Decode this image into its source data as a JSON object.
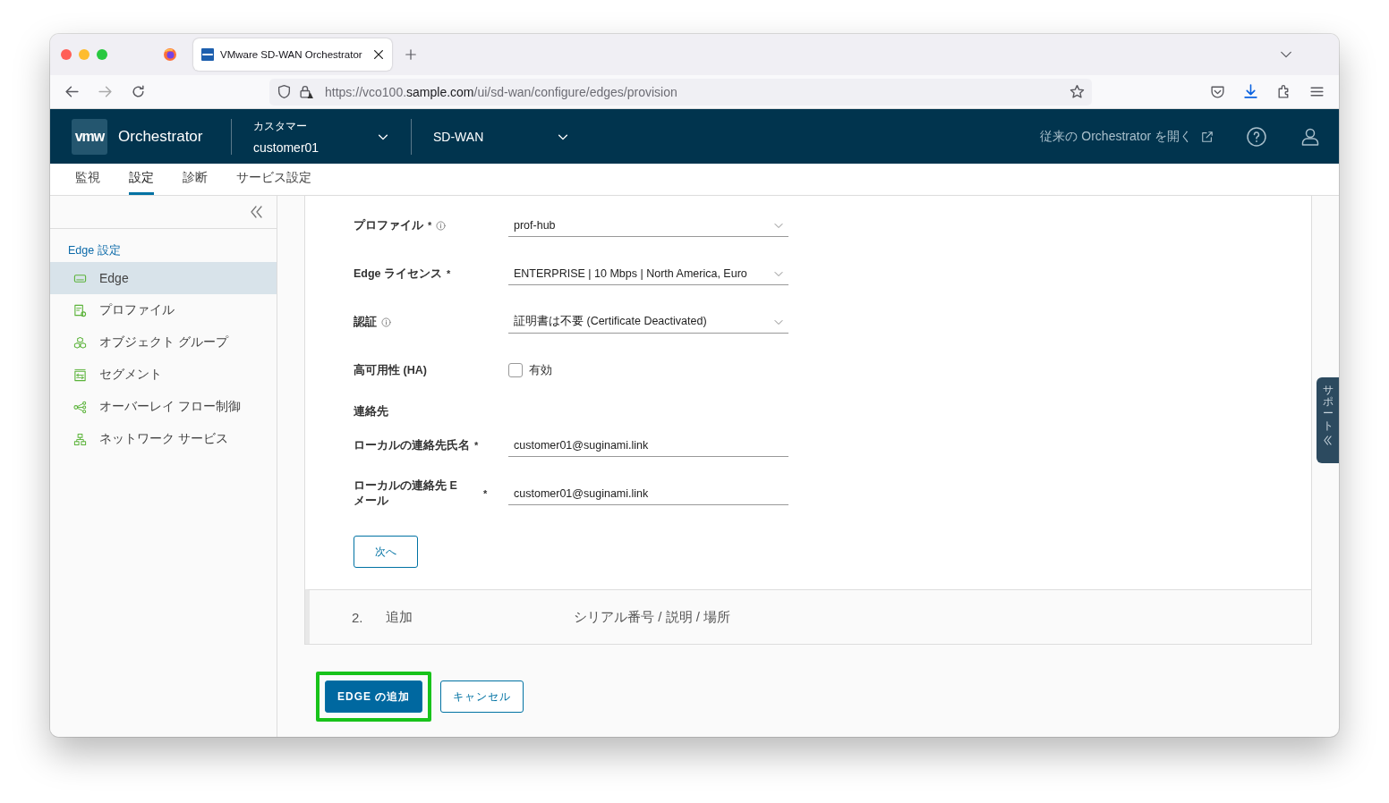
{
  "browser": {
    "tab": {
      "title": "VMware SD-WAN Orchestrator",
      "selected": true
    },
    "url": {
      "scheme": "https://vco100.",
      "domain": "sample.com",
      "path": "/ui/sd-wan/configure/edges/provision"
    }
  },
  "header": {
    "logo": "vmw",
    "product": "Orchestrator",
    "customer_label": "カスタマー",
    "customer": "customer01",
    "service": "SD-WAN",
    "legacy_link": "従来の Orchestrator を開く"
  },
  "nav_tabs": [
    {
      "label": "監視",
      "selected": false
    },
    {
      "label": "設定",
      "selected": true
    },
    {
      "label": "診断",
      "selected": false
    },
    {
      "label": "サービス設定",
      "selected": false
    }
  ],
  "sidebar": {
    "section": "Edge 設定",
    "items": [
      {
        "label": "Edge",
        "selected": true
      },
      {
        "label": "プロファイル",
        "selected": false
      },
      {
        "label": "オブジェクト グループ",
        "selected": false
      },
      {
        "label": "セグメント",
        "selected": false
      },
      {
        "label": "オーバーレイ フロー制御",
        "selected": false
      },
      {
        "label": "ネットワーク サービス",
        "selected": false
      }
    ]
  },
  "form": {
    "fields": [
      {
        "kind": "select",
        "label": "プロファイル",
        "required_mark": "*",
        "info": true,
        "value": "prof-hub"
      },
      {
        "kind": "select",
        "label": "Edge ライセンス",
        "required_mark": "*",
        "value": "ENTERPRISE | 10 Mbps | North America, Euro"
      },
      {
        "kind": "select",
        "label": "認証",
        "info": true,
        "value": "証明書は不要 (Certificate Deactivated)"
      },
      {
        "kind": "checkbox",
        "label": "高可用性 (HA)",
        "option": "有効",
        "checked": false
      },
      {
        "kind": "heading",
        "label": "連絡先"
      },
      {
        "kind": "text",
        "label": "ローカルの連絡先氏名",
        "required_mark": "*",
        "value": "customer01@suginami.link"
      },
      {
        "kind": "text",
        "label": "ローカルの連絡先 E メール",
        "required_mark": "*",
        "value": "customer01@suginami.link"
      }
    ],
    "next_button": "次へ"
  },
  "step": {
    "number": "2.",
    "title": "追加",
    "description": "シリアル番号 / 説明 / 場所"
  },
  "actions": [
    {
      "label": "EDGE の追加",
      "kind": "primary",
      "highlighted": true
    },
    {
      "label": "キャンセル",
      "kind": "secondary"
    }
  ],
  "support_tab": "サポート"
}
